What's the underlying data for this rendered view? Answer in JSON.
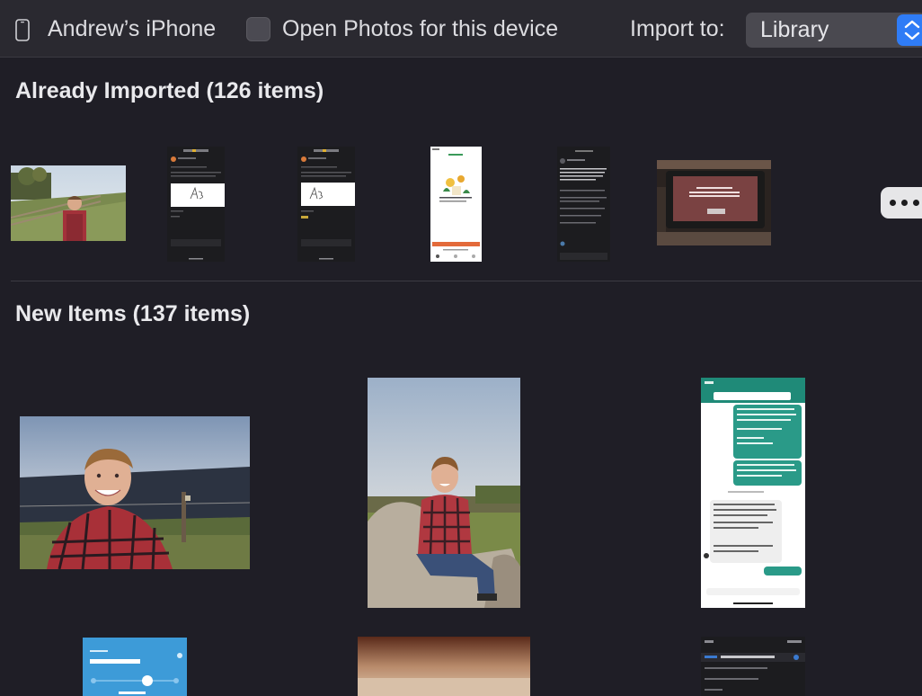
{
  "header": {
    "device_icon": "iphone-icon",
    "device_name": "Andrew’s iPhone",
    "open_photos_checkbox_label": "Open Photos for this device",
    "open_photos_checked": false,
    "import_to_label": "Import to:",
    "import_to_value": "Library",
    "import_to_icon": "updown-chevron-icon"
  },
  "already_imported": {
    "title": "Already Imported (126 items)",
    "items": [
      {
        "kind": "photo",
        "subject": "man in field by fence"
      },
      {
        "kind": "screenshot",
        "subject": "delivery email with signature"
      },
      {
        "kind": "screenshot",
        "subject": "delivery email with signature"
      },
      {
        "kind": "screenshot",
        "subject": "transfer confirmation app"
      },
      {
        "kind": "screenshot",
        "subject": "dark email"
      },
      {
        "kind": "photo",
        "subject": "car dashboard display"
      }
    ],
    "more_icon": "ellipsis-icon"
  },
  "new_items": {
    "title": "New Items (137 items)",
    "items": [
      {
        "kind": "photo",
        "subject": "man in plaid shirt by fence"
      },
      {
        "kind": "photo",
        "subject": "man sitting on rock"
      },
      {
        "kind": "screenshot",
        "subject": "chat conversation"
      },
      {
        "kind": "screenshot",
        "subject": "Your Packages app"
      },
      {
        "kind": "photo",
        "subject": "blurred photo"
      },
      {
        "kind": "screenshot",
        "subject": "dark email"
      }
    ]
  },
  "colors": {
    "background": "#1f1e26",
    "toolbar": "#2a2930",
    "accent": "#2f7cf6"
  }
}
